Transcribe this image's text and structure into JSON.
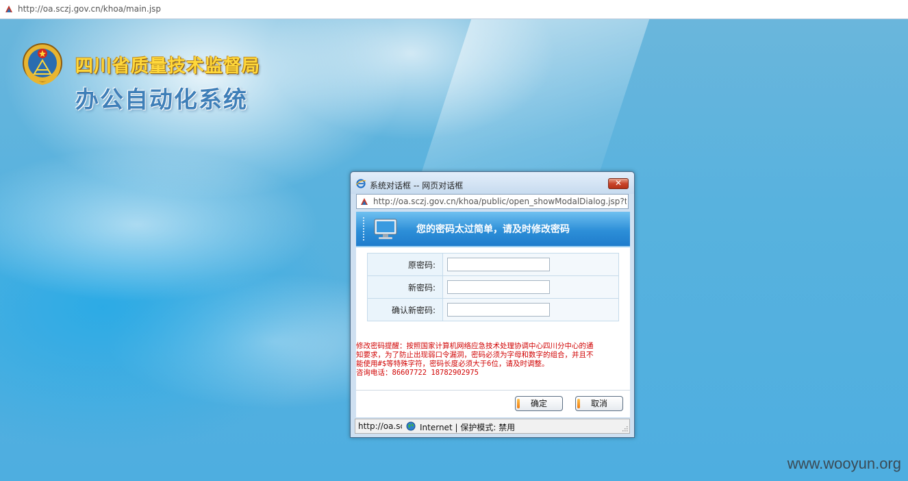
{
  "browser": {
    "url": "http://oa.sczj.gov.cn/khoa/main.jsp"
  },
  "header": {
    "org_name": "四川省质量技术监督局",
    "system_name": "办公自动化系统"
  },
  "dialog": {
    "title": "系统对话框 -- 网页对话框",
    "close_label": "✕",
    "url": "http://oa.sczj.gov.cn/khoa/public/open_showModalDialog.jsp?t",
    "heading": "您的密码太过简单，请及时修改密码",
    "form": {
      "old_password_label": "原密码:",
      "new_password_label": "新密码:",
      "confirm_password_label": "确认新密码:"
    },
    "notice": {
      "line1": "修改密码提醒：按照国家计算机网络应急技术处理协调中心四川分中心的通",
      "line2": "知要求，为了防止出现弱口令漏洞，密码必须为字母和数字的组合，并且不",
      "line3": "能使用#$等特殊字符，密码长度必须大于6位，请及时调整。",
      "line4": "咨询电话：86607722 18782902975"
    },
    "buttons": {
      "ok": "确定",
      "cancel": "取消"
    },
    "status": {
      "url": "http://oa.sczj.gov.cn",
      "zone": "Internet | 保护模式: 禁用"
    }
  },
  "watermark": "www.wooyun.org",
  "colors": {
    "background": "#5ab4dc",
    "banner": "#2d8fd8",
    "notice_text": "#d00000",
    "org_name": "#ffd83a"
  },
  "icons": [
    "site-icon",
    "emblem-icon",
    "ie-icon",
    "monitor-icon",
    "globe-icon"
  ]
}
